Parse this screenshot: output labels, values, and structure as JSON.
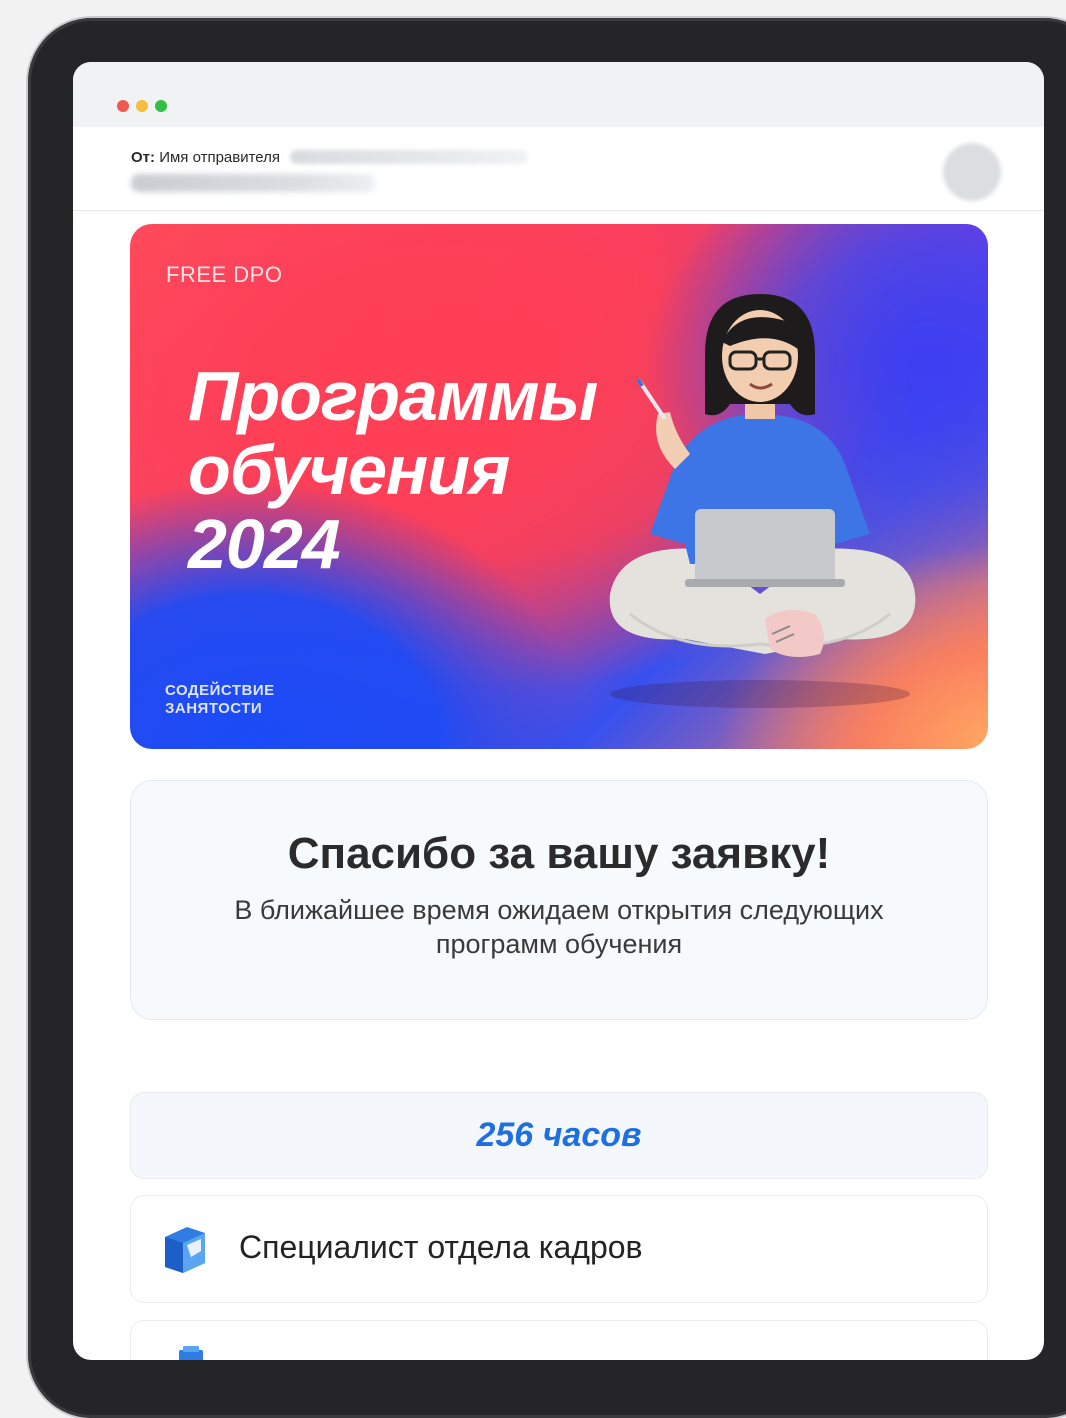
{
  "window": {
    "traffic_lights": [
      "close",
      "minimize",
      "zoom"
    ]
  },
  "mail": {
    "from_label": "От:",
    "sender_name": "Имя отправителя",
    "sender_email_blurred": true,
    "subject_blurred": true
  },
  "banner": {
    "brand": "FREE DPO",
    "title_lines": [
      "Программы",
      "обучения",
      "2024"
    ],
    "footer_line1": "СОДЕЙСТВИЕ",
    "footer_line2": "ЗАНЯТОСТИ"
  },
  "thanks": {
    "title": "Спасибо за вашу заявку!",
    "subtitle": "В ближайшее время ожидаем открытия следующих программ обучения"
  },
  "programs": {
    "hours_label": "256 часов",
    "items": [
      {
        "label": "Специалист отдела кадров",
        "icon": "folder-icon"
      }
    ]
  },
  "colors": {
    "accent_blue": "#1e6fe0",
    "banner_red": "#ff3f55",
    "banner_blue": "#1b4bf7"
  }
}
